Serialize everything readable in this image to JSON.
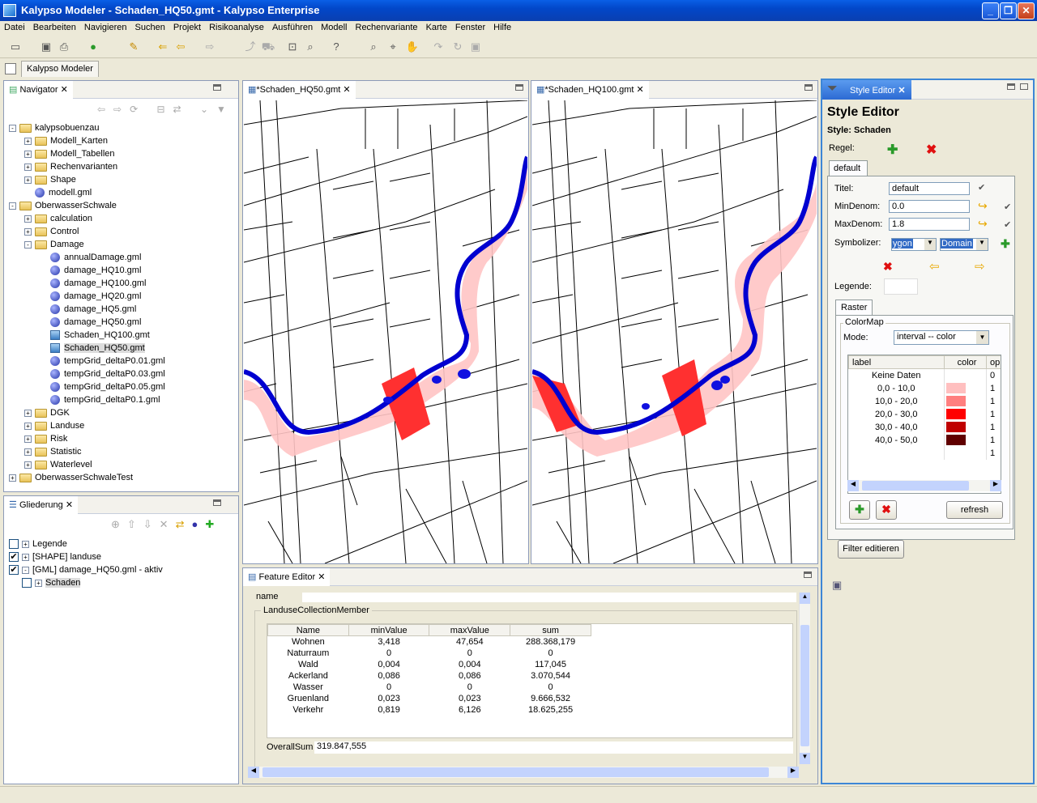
{
  "app": {
    "title": "Kalypso Modeler - Schaden_HQ50.gmt - Kalypso Enterprise",
    "perspective": "Kalypso Modeler"
  },
  "menu": [
    "Datei",
    "Bearbeiten",
    "Navigieren",
    "Suchen",
    "Projekt",
    "Risikoanalyse",
    "Ausführen",
    "Modell",
    "Rechenvariante",
    "Karte",
    "Fenster",
    "Hilfe"
  ],
  "navigator": {
    "title": "Navigator",
    "items": [
      {
        "label": "kalypsobuenzau",
        "level": 0,
        "type": "folder",
        "exp": "-"
      },
      {
        "label": "Modell_Karten",
        "level": 1,
        "type": "folder",
        "exp": "+"
      },
      {
        "label": "Modell_Tabellen",
        "level": 1,
        "type": "folder",
        "exp": "+"
      },
      {
        "label": "Rechenvarianten",
        "level": 1,
        "type": "folder",
        "exp": "+"
      },
      {
        "label": "Shape",
        "level": 1,
        "type": "folder",
        "exp": "+"
      },
      {
        "label": "modell.gml",
        "level": 1,
        "type": "gml",
        "exp": ""
      },
      {
        "label": "OberwasserSchwale",
        "level": 0,
        "type": "folder",
        "exp": "-"
      },
      {
        "label": "calculation",
        "level": 1,
        "type": "folder",
        "exp": "+"
      },
      {
        "label": "Control",
        "level": 1,
        "type": "folder",
        "exp": "+"
      },
      {
        "label": "Damage",
        "level": 1,
        "type": "folder",
        "exp": "-"
      },
      {
        "label": "annualDamage.gml",
        "level": 2,
        "type": "gml",
        "exp": ""
      },
      {
        "label": "damage_HQ10.gml",
        "level": 2,
        "type": "gml",
        "exp": ""
      },
      {
        "label": "damage_HQ100.gml",
        "level": 2,
        "type": "gml",
        "exp": ""
      },
      {
        "label": "damage_HQ20.gml",
        "level": 2,
        "type": "gml",
        "exp": ""
      },
      {
        "label": "damage_HQ5.gml",
        "level": 2,
        "type": "gml",
        "exp": ""
      },
      {
        "label": "damage_HQ50.gml",
        "level": 2,
        "type": "gml",
        "exp": ""
      },
      {
        "label": "Schaden_HQ100.gmt",
        "level": 2,
        "type": "gmt",
        "exp": ""
      },
      {
        "label": "Schaden_HQ50.gmt",
        "level": 2,
        "type": "gmt",
        "exp": "",
        "selected": true
      },
      {
        "label": "tempGrid_deltaP0.01.gml",
        "level": 2,
        "type": "gml",
        "exp": ""
      },
      {
        "label": "tempGrid_deltaP0.03.gml",
        "level": 2,
        "type": "gml",
        "exp": ""
      },
      {
        "label": "tempGrid_deltaP0.05.gml",
        "level": 2,
        "type": "gml",
        "exp": ""
      },
      {
        "label": "tempGrid_deltaP0.1.gml",
        "level": 2,
        "type": "gml",
        "exp": ""
      },
      {
        "label": "DGK",
        "level": 1,
        "type": "folder",
        "exp": "+"
      },
      {
        "label": "Landuse",
        "level": 1,
        "type": "folder",
        "exp": "+"
      },
      {
        "label": "Risk",
        "level": 1,
        "type": "folder",
        "exp": "+"
      },
      {
        "label": "Statistic",
        "level": 1,
        "type": "folder",
        "exp": "+"
      },
      {
        "label": "Waterlevel",
        "level": 1,
        "type": "folder",
        "exp": "+"
      },
      {
        "label": "OberwasserSchwaleTest",
        "level": 0,
        "type": "folder",
        "exp": "+"
      }
    ]
  },
  "outline": {
    "title": "Gliederung",
    "items": [
      {
        "label": "Legende",
        "checked": false,
        "level": 0
      },
      {
        "label": "[SHAPE] landuse",
        "checked": true,
        "level": 0
      },
      {
        "label": "[GML] damage_HQ50.gml - aktiv",
        "checked": true,
        "level": 0,
        "exp": "-"
      },
      {
        "label": "Schaden",
        "checked": false,
        "level": 1,
        "selected": true
      }
    ]
  },
  "editors": {
    "map1": "*Schaden_HQ50.gmt",
    "map2": "*Schaden_HQ100.gmt"
  },
  "feature": {
    "title": "Feature Editor",
    "name_label": "name",
    "group": "LanduseCollectionMember",
    "columns": [
      "Name",
      "minValue",
      "maxValue",
      "sum"
    ],
    "rows": [
      [
        "Wohnen",
        "3,418",
        "47,654",
        "288.368,179"
      ],
      [
        "Naturraum",
        "0",
        "0",
        "0"
      ],
      [
        "Wald",
        "0,004",
        "0,004",
        "117,045"
      ],
      [
        "Ackerland",
        "0,086",
        "0,086",
        "3.070,544"
      ],
      [
        "Wasser",
        "0",
        "0",
        "0"
      ],
      [
        "Gruenland",
        "0,023",
        "0,023",
        "9.666,532"
      ],
      [
        "Verkehr",
        "0,819",
        "6,126",
        "18.625,255"
      ]
    ],
    "overall_label": "OverallSum",
    "overall_value": "319.847,555"
  },
  "style": {
    "tab": "Style Editor",
    "heading": "Style Editor",
    "style_label": "Style: Schaden",
    "regel": "Regel:",
    "rule_tab": "default",
    "titel_label": "Titel:",
    "titel": "default",
    "mindenom_label": "MinDenom:",
    "mindenom": "0.0",
    "maxdenom_label": "MaxDenom:",
    "maxdenom": "1.8",
    "symbolizer_label": "Symbolizer:",
    "symb1": "ygon",
    "symb2": "Domain",
    "legende_label": "Legende:",
    "raster_tab": "Raster",
    "colormap_label": "ColorMap",
    "mode_label": "Mode:",
    "mode": "interval -- color",
    "cm_columns": [
      "label",
      "color",
      "op."
    ],
    "cm_rows": [
      {
        "label": "Keine Daten",
        "color": "#ffffff",
        "op": "0"
      },
      {
        "label": "0,0 - 10,0",
        "color": "#ffbfbf",
        "op": "1"
      },
      {
        "label": "10,0 - 20,0",
        "color": "#ff7f7f",
        "op": "1"
      },
      {
        "label": "20,0 - 30,0",
        "color": "#ff0000",
        "op": "1"
      },
      {
        "label": "30,0 - 40,0",
        "color": "#bf0000",
        "op": "1"
      },
      {
        "label": "40,0 - 50,0",
        "color": "#600000",
        "op": "1"
      },
      {
        "label": "",
        "color": "#ffffff",
        "op": "1"
      }
    ],
    "refresh": "refresh",
    "filter": "Filter editieren"
  }
}
